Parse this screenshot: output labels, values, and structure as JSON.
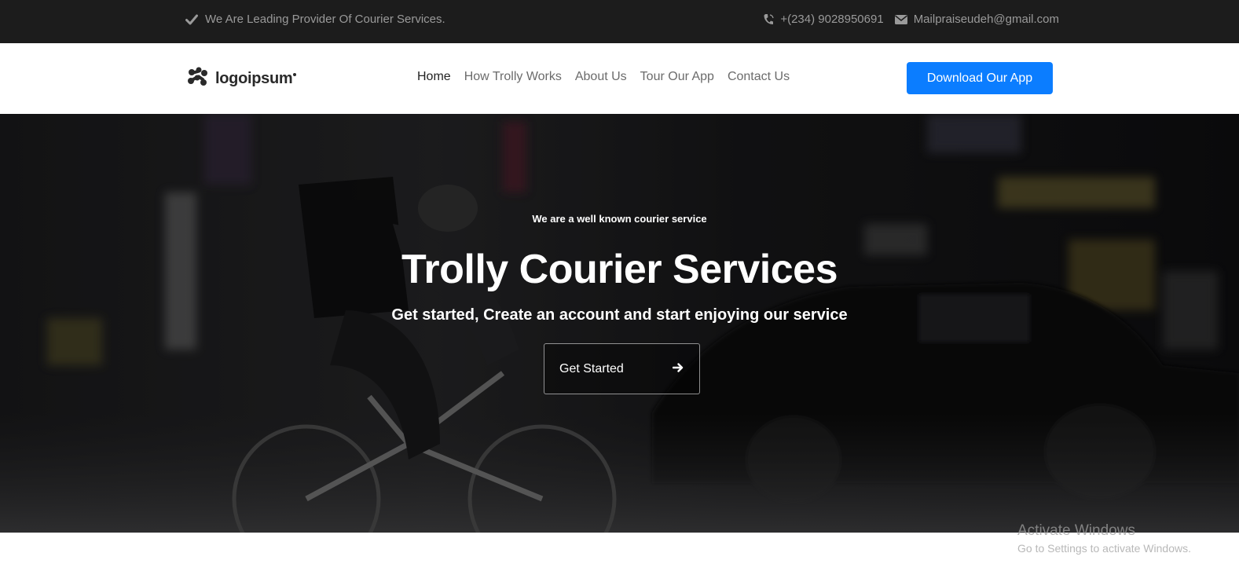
{
  "topbar": {
    "tagline": "We Are Leading Provider Of Courier Services.",
    "phone": "+(234) 9028950691",
    "email": "Mailpraiseudeh@gmail.com",
    "icons": {
      "tagline": "check-icon",
      "phone": "phone-icon",
      "email": "envelope-icon"
    }
  },
  "navbar": {
    "logo_text": "logoipsum",
    "links": [
      {
        "label": "Home",
        "active": true
      },
      {
        "label": "How Trolly Works",
        "active": false
      },
      {
        "label": "About Us",
        "active": false
      },
      {
        "label": "Tour Our App",
        "active": false
      },
      {
        "label": "Contact Us",
        "active": false
      }
    ],
    "cta_label": "Download Our App"
  },
  "hero": {
    "tagline": "We are a well known courier service",
    "title": "Trolly Courier Services",
    "subtitle": "Get started, Create an account and start enjoying our service",
    "button_label": "Get Started",
    "button_icon": "arrow-right-icon"
  },
  "watermark": {
    "title": "Activate Windows",
    "subtitle": "Go to Settings to activate Windows."
  },
  "colors": {
    "topbar_bg": "#1c1c1c",
    "accent": "#0b7dff",
    "nav_text": "#6b6b6b",
    "nav_active": "#222222"
  }
}
